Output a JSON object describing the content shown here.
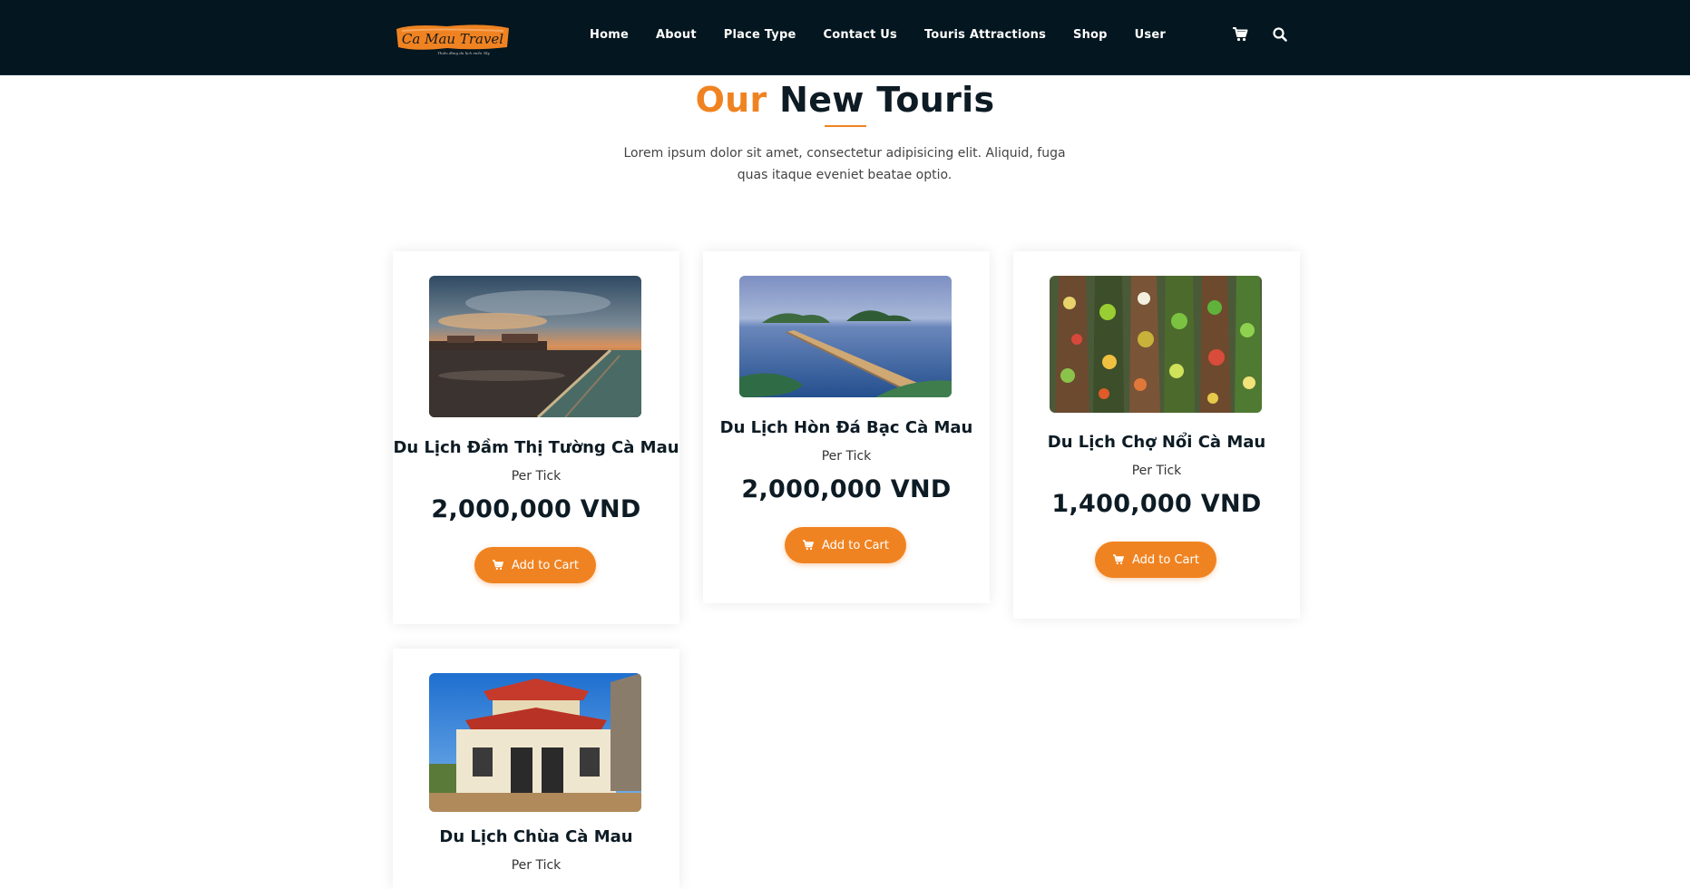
{
  "brand": {
    "logo_text": "Ca Mau Travel",
    "logo_tagline": "Thiên đàng du lịch miền Tây",
    "accent_color": "#f08321",
    "nav_bg": "#04161f"
  },
  "nav": {
    "links": [
      "Home",
      "About",
      "Place Type",
      "Contact Us",
      "Touris Attractions",
      "Shop",
      "User"
    ],
    "icons": [
      "cart-icon",
      "search-icon"
    ]
  },
  "section": {
    "title_accent": "Our",
    "title_main": "New Touris",
    "description": "Lorem ipsum dolor sit amet, consectetur adipisicing elit. Aliquid, fuga quas itaque eveniet beatae optio."
  },
  "products": [
    {
      "title": "Du Lịch Đầm Thị Tường Cà Mau",
      "unit": "Per Tick",
      "price": "2,000,000 VND",
      "button": "Add to Cart",
      "image": "lagoon-sunset-photo"
    },
    {
      "title": "Du Lịch Hòn Đá Bạc Cà Mau",
      "unit": "Per Tick",
      "price": "2,000,000 VND",
      "button": "Add to Cart",
      "image": "island-bridge-photo"
    },
    {
      "title": "Du Lịch Chợ Nổi Cà Mau",
      "unit": "Per Tick",
      "price": "1,400,000 VND",
      "button": "Add to Cart",
      "image": "floating-market-photo"
    },
    {
      "title": "Du Lịch Chùa Cà Mau",
      "unit": "Per Tick",
      "price": "",
      "button": "",
      "image": "pagoda-photo"
    }
  ]
}
